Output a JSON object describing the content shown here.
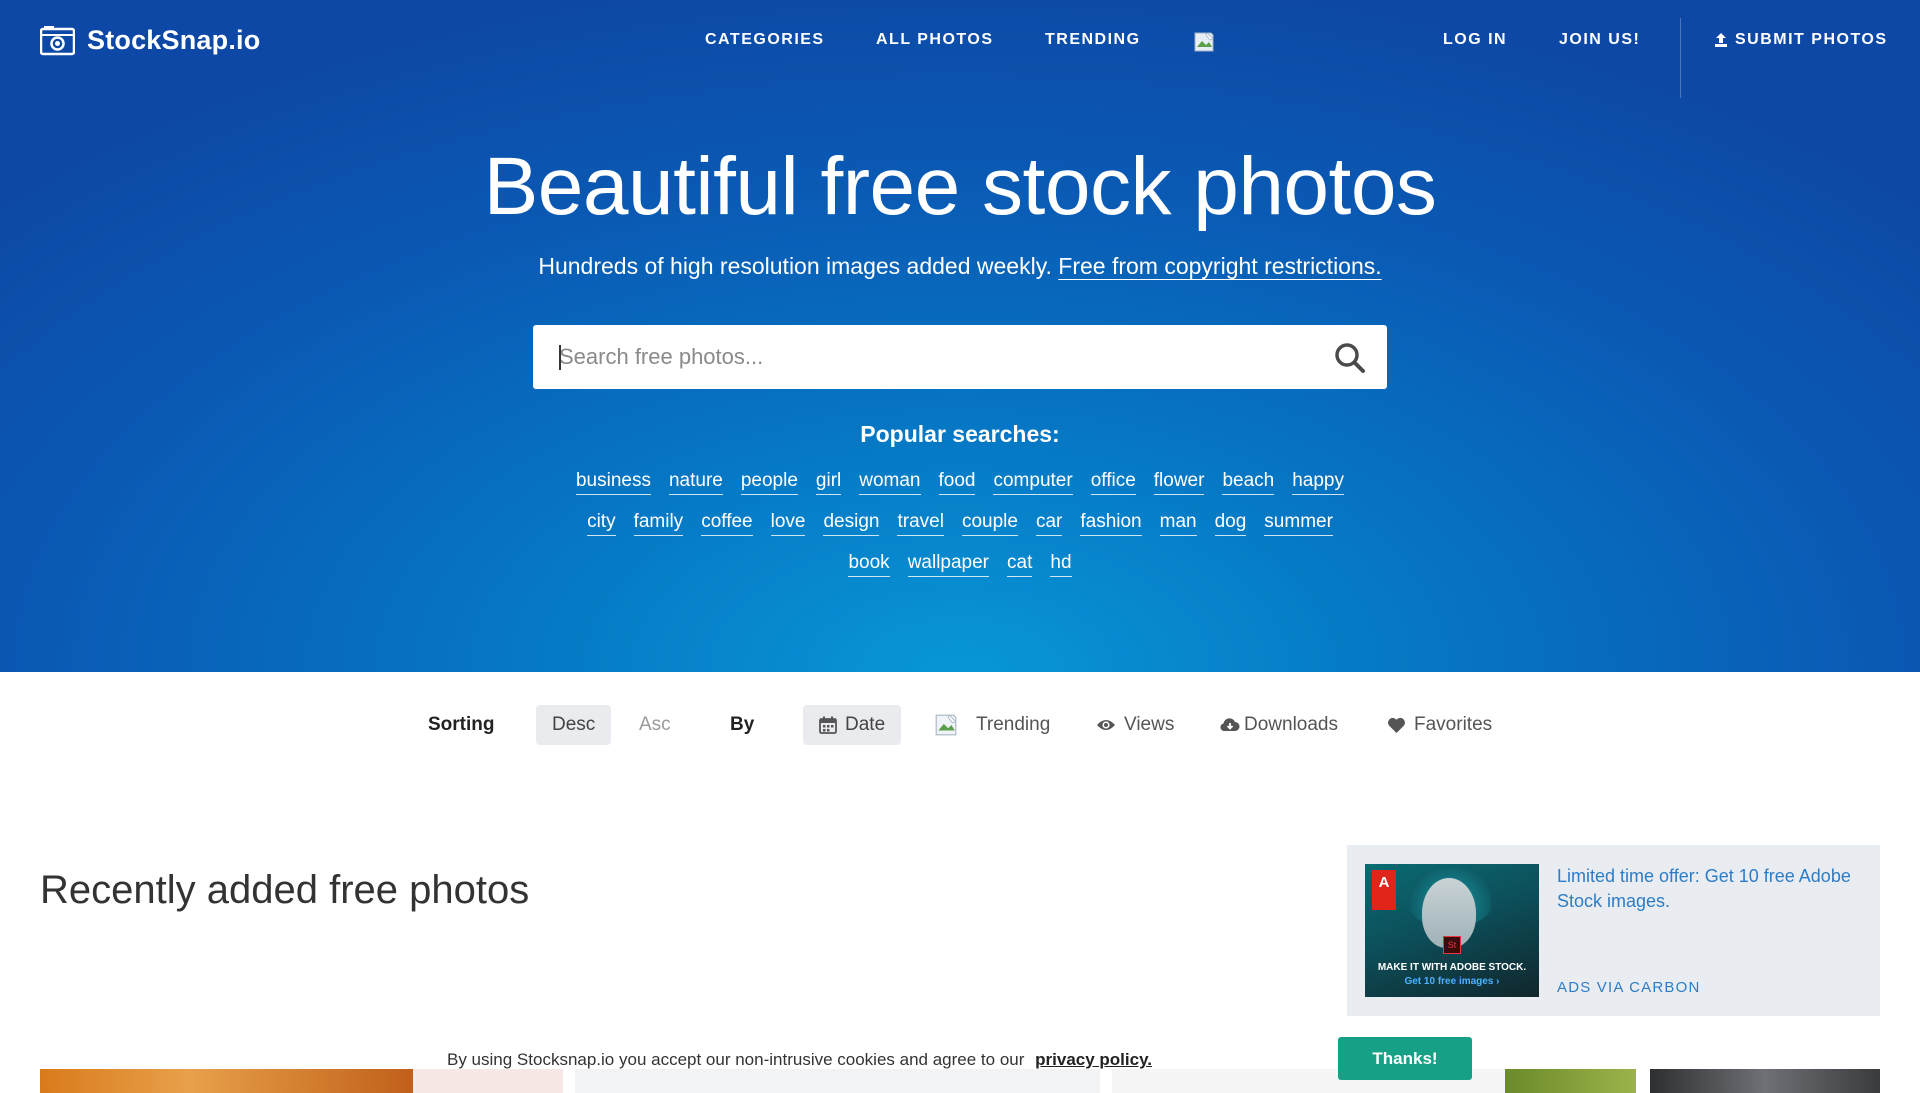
{
  "header": {
    "logo_text": "StockSnap.io",
    "nav": [
      "CATEGORIES",
      "ALL PHOTOS",
      "TRENDING"
    ],
    "login": "LOG IN",
    "join": "JOIN US!",
    "submit": "SUBMIT PHOTOS"
  },
  "hero": {
    "title": "Beautiful free stock photos",
    "subtitle": "Hundreds of high resolution images added weekly.",
    "subtitle_link": "Free from copyright restrictions.",
    "search_placeholder": "Search free photos...",
    "popular_title": "Popular searches:",
    "tags_row1": [
      "business",
      "nature",
      "people",
      "girl",
      "woman",
      "food",
      "computer",
      "office",
      "flower",
      "beach",
      "happy"
    ],
    "tags_row2": [
      "city",
      "family",
      "coffee",
      "love",
      "design",
      "travel",
      "couple",
      "car",
      "fashion",
      "man",
      "dog",
      "summer"
    ],
    "tags_row3": [
      "book",
      "wallpaper",
      "cat",
      "hd"
    ]
  },
  "sorting": {
    "label": "Sorting",
    "desc": "Desc",
    "asc": "Asc",
    "by": "By",
    "date": "Date",
    "trending": "Trending",
    "views": "Views",
    "downloads": "Downloads",
    "favorites": "Favorites"
  },
  "main": {
    "section_title": "Recently added free photos"
  },
  "ad": {
    "text": "Limited time offer: Get 10 free Adobe Stock images.",
    "via": "ADS VIA CARBON",
    "image_line1": "MAKE IT WITH ADOBE STOCK.",
    "image_line2": "Get 10 free images ›",
    "image_logo": "A",
    "image_badge": "St"
  },
  "cookie": {
    "text": "By using Stocksnap.io you accept our non-intrusive cookies and agree to our",
    "link": "privacy policy.",
    "button": "Thanks!"
  },
  "colors": {
    "hero_top": "#0d48a6",
    "hero_bottom": "#0896d8",
    "accent_link": "#2d7cc7",
    "cookie_button": "#16a085"
  },
  "icons": [
    "camera-logo-icon",
    "broken-image-icon",
    "upload-icon",
    "search-icon",
    "calendar-icon",
    "eye-icon",
    "cloud-download-icon",
    "heart-icon"
  ]
}
